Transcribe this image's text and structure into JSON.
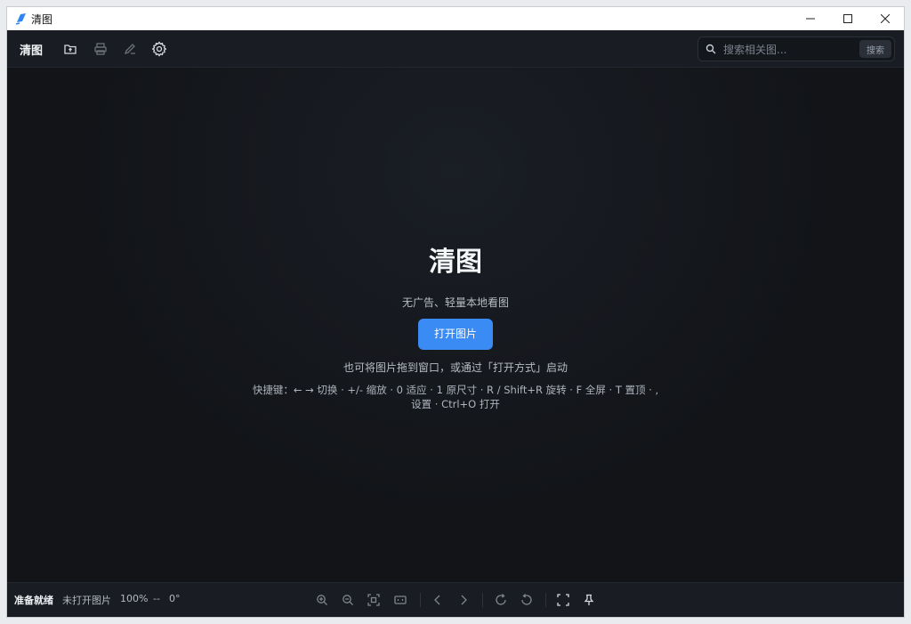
{
  "window": {
    "title": "清图"
  },
  "toolbar": {
    "brand": "清图",
    "icons": [
      "open-folder-icon",
      "print-icon",
      "edit-icon",
      "settings-icon"
    ]
  },
  "search": {
    "placeholder": "搜索相关图...",
    "value": "",
    "button_label": "搜索"
  },
  "welcome": {
    "title": "清图",
    "tagline": "无广告、轻量本地看图",
    "open_button": "打开图片",
    "drag_hint": "也可将图片拖到窗口，或通过「打开方式」启动",
    "shortcuts": "快捷键：← → 切换 · +/- 缩放 · 0 适应 · 1 原尺寸 · R / Shift+R 旋转 · F 全屏 · T 置顶 · , 设置 · Ctrl+O 打开"
  },
  "status": {
    "state": "准备就绪",
    "file": "未打开图片",
    "zoom": "100%",
    "dimensions": "--",
    "rotation": "0°"
  },
  "statusbar_icons": [
    "zoom-in-icon",
    "zoom-out-icon",
    "fit-icon",
    "actual-size-icon",
    "prev-icon",
    "next-icon",
    "rotate-right-icon",
    "rotate-left-icon",
    "fullscreen-icon",
    "pin-icon"
  ],
  "colors": {
    "accent": "#3b8bf5",
    "background": "#121418",
    "toolbar": "#191c22"
  }
}
